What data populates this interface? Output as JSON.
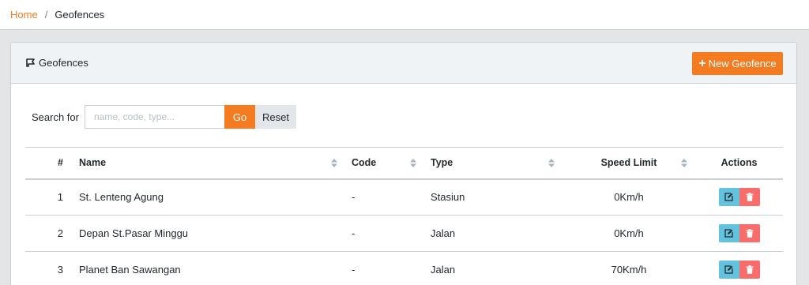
{
  "breadcrumb": {
    "home": "Home",
    "separator": "/",
    "current": "Geofences"
  },
  "card": {
    "title": "Geofences",
    "title_icon": "map-marker-icon",
    "new_button": {
      "icon": "plus-icon",
      "label": "New Geofence"
    }
  },
  "search": {
    "label": "Search for",
    "placeholder": "name, code, type...",
    "value": "",
    "go_label": "Go",
    "reset_label": "Reset"
  },
  "table": {
    "headers": {
      "num": "#",
      "name": "Name",
      "code": "Code",
      "type": "Type",
      "speed": "Speed Limit",
      "actions": "Actions"
    },
    "rows": [
      {
        "num": "1",
        "name": "St. Lenteng Agung",
        "code": "-",
        "type": "Stasiun",
        "speed": "0Km/h"
      },
      {
        "num": "2",
        "name": "Depan St.Pasar Minggu",
        "code": "-",
        "type": "Jalan",
        "speed": "0Km/h"
      },
      {
        "num": "3",
        "name": "Planet Ban Sawangan",
        "code": "-",
        "type": "Jalan",
        "speed": "70Km/h"
      }
    ]
  },
  "colors": {
    "accent": "#f47b20",
    "edit": "#63c2de",
    "delete": "#f86c6b",
    "header_bg": "#f0f3f5",
    "page_bg": "#e4e5e6"
  }
}
